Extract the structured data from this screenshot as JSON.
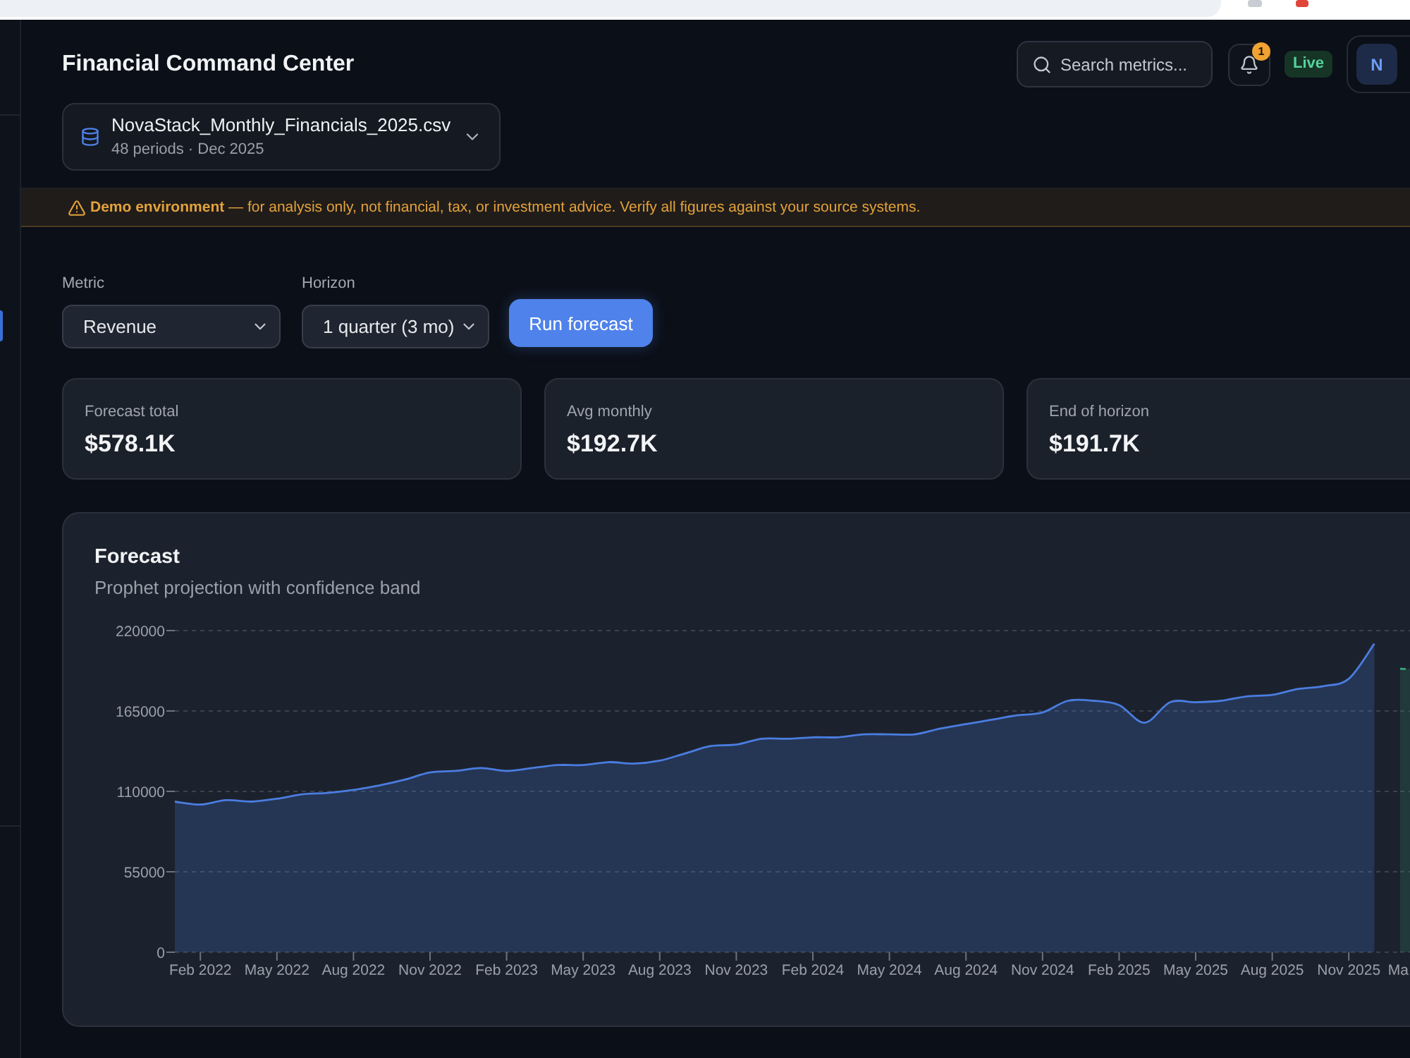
{
  "header": {
    "title": "Financial Command Center",
    "search": {
      "label": "Search metrics..."
    },
    "notification_count": "1",
    "status_badge": "Live",
    "user": {
      "initial": "N"
    }
  },
  "dataset": {
    "file_name": "NovaStack_Monthly_Financials_2025.csv",
    "meta": "48 periods · Dec 2025"
  },
  "notice": {
    "text": "**Demo environment** — for analysis only, not financial, tax, or investment advice. Verify all figures against your source systems."
  },
  "controls": {
    "fields": [
      {
        "label": "Metric",
        "value": "Revenue"
      },
      {
        "label": "Horizon",
        "value": "1 quarter (3 mo)"
      }
    ],
    "run_button": "Run forecast"
  },
  "kpis": [
    {
      "label": "Forecast total",
      "value": "$578.1K"
    },
    {
      "label": "Avg monthly",
      "value": "$192.7K"
    },
    {
      "label": "End of horizon",
      "value": "$191.7K"
    }
  ],
  "forecast_card": {
    "title": "Forecast",
    "subtitle": "Prophet projection with confidence band",
    "clipped_x_label": "Ma",
    "chart_data": {
      "type": "area",
      "grid": true,
      "categories": [
        null,
        "Feb 2022",
        null,
        null,
        "May 2022",
        null,
        null,
        "Aug 2022",
        null,
        null,
        "Nov 2022",
        null,
        null,
        "Feb 2023",
        null,
        null,
        "May 2023",
        null,
        null,
        "Aug 2023",
        null,
        null,
        "Nov 2023",
        null,
        null,
        "Feb 2024",
        null,
        null,
        "May 2024",
        null,
        null,
        "Aug 2024",
        null,
        null,
        "Nov 2024",
        null,
        null,
        "Feb 2025",
        null,
        null,
        "May 2025",
        null,
        null,
        "Aug 2025",
        null,
        null,
        "Nov 2025",
        null
      ],
      "series": [
        {
          "color": "#4a7de0",
          "values": [
            103000,
            101000,
            104000,
            103000,
            105000,
            108000,
            109000,
            111000,
            114000,
            118000,
            123000,
            124000,
            126000,
            124000,
            126000,
            128000,
            128000,
            130000,
            129000,
            131000,
            136000,
            141000,
            142000,
            146000,
            146000,
            147000,
            147000,
            149000,
            149000,
            149000,
            153000,
            156000,
            159000,
            162000,
            164000,
            172000,
            172000,
            169000,
            157000,
            171000,
            171000,
            172000,
            175000,
            176000,
            180000,
            182000,
            187000,
            211000
          ]
        }
      ],
      "ylim": [
        0,
        220000
      ],
      "yticks": [
        0,
        55000,
        110000,
        165000,
        220000
      ]
    }
  }
}
